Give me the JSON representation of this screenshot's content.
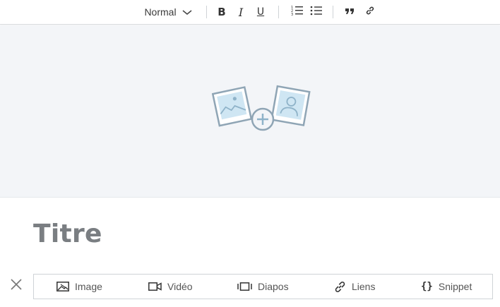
{
  "toolbar": {
    "paragraph_style": "Normal",
    "bold_label": "B",
    "italic_label": "I",
    "underline_label": "U",
    "icons": [
      "chevron-down-icon",
      "numbered-list-icon",
      "bullet-list-icon",
      "quote-icon",
      "link-icon"
    ]
  },
  "cover": {
    "icon": "add-image-icon",
    "accent_color": "#8fb3c9",
    "fill_color": "#cfe6f3"
  },
  "title": "Titre",
  "insert_bar": {
    "items": [
      {
        "label": "Image",
        "icon": "image-icon"
      },
      {
        "label": "Vidéo",
        "icon": "video-icon"
      },
      {
        "label": "Diapos",
        "icon": "slideshow-icon"
      },
      {
        "label": "Liens",
        "icon": "link-icon"
      },
      {
        "label": "Snippet",
        "icon": "braces-icon",
        "glyph": "{}"
      }
    ],
    "close_icon": "close-icon"
  }
}
